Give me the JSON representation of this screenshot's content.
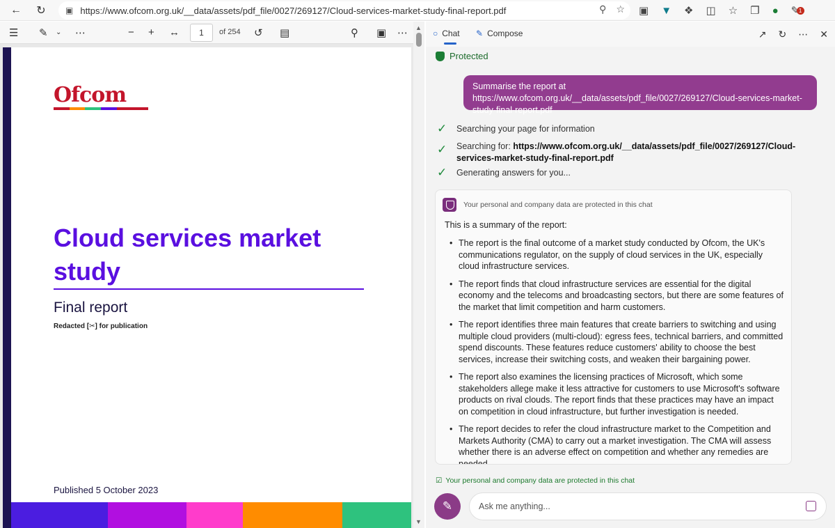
{
  "browser": {
    "url": "https://www.ofcom.org.uk/__data/assets/pdf_file/0027/269127/Cloud-services-market-study-final-report.pdf",
    "icons": [
      "back-icon",
      "refresh-icon",
      "lock-icon",
      "zoom-icon",
      "favorite-icon",
      "camera-icon",
      "extension-icon",
      "puzzle-icon",
      "split-screen-icon",
      "favorites-icon",
      "collections-icon",
      "profile-icon"
    ],
    "notification_badge": "1"
  },
  "pdf_toolbar": {
    "page_number": "1",
    "page_count": "of 254"
  },
  "pdf_page": {
    "logo_text": "Ofcom",
    "title": "Cloud services market study",
    "subtitle": "Final report",
    "redacted": "Redacted [✂] for publication",
    "published": "Published 5 October 2023",
    "stripe_colors": [
      "#4b1de0",
      "#b10fe0",
      "#ff3ccb",
      "#ff8c00",
      "#2ec27e"
    ],
    "logo_bar_colors": [
      "#c3152b",
      "#ff8c00",
      "#2ec27e",
      "#5a0fe0",
      "#c3152b"
    ]
  },
  "pane": {
    "tab_chat": "Chat",
    "tab_compose": "Compose",
    "protected_label": "Protected",
    "user_message": "Summarise the report at https://www.ofcom.org.uk/__data/assets/pdf_file/0027/269127/Cloud-services-market-study-final-report.pdf",
    "step_1": "Searching your page for information",
    "step_2_prefix": "Searching for:",
    "step_2_query": "https://www.ofcom.org.uk/__data/assets/pdf_file/0027/269127/Cloud-services-market-study-final-report.pdf",
    "step_3": "Generating answers for you...",
    "answer_header": "Your personal and company data are protected in this chat",
    "answer_intro": "This is a summary of the report:",
    "bullets": [
      "The report is the final outcome of a market study conducted by Ofcom, the UK's communications regulator, on the supply of cloud services in the UK, especially cloud infrastructure services.",
      "The report finds that cloud infrastructure services are essential for the digital economy and the telecoms and broadcasting sectors, but there are some features of the market that limit competition and harm customers.",
      "The report identifies three main features that create barriers to switching and using multiple cloud providers (multi-cloud): egress fees, technical barriers, and committed spend discounts. These features reduce customers' ability to choose the best services, increase their switching costs, and weaken their bargaining power.",
      "The report also examines the licensing practices of Microsoft, which some stakeholders allege make it less attractive for customers to use Microsoft's software products on rival clouds. The report finds that these practices may have an impact on competition in cloud infrastructure, but further investigation is needed.",
      "The report decides to refer the cloud infrastructure market to the Competition and Markets Authority (CMA) to carry out a market investigation. The CMA will assess whether there is an adverse effect on competition and whether any remedies are needed."
    ],
    "privacy_note": "Your personal and company data are protected in this chat",
    "ask_placeholder": "Ask me anything..."
  }
}
